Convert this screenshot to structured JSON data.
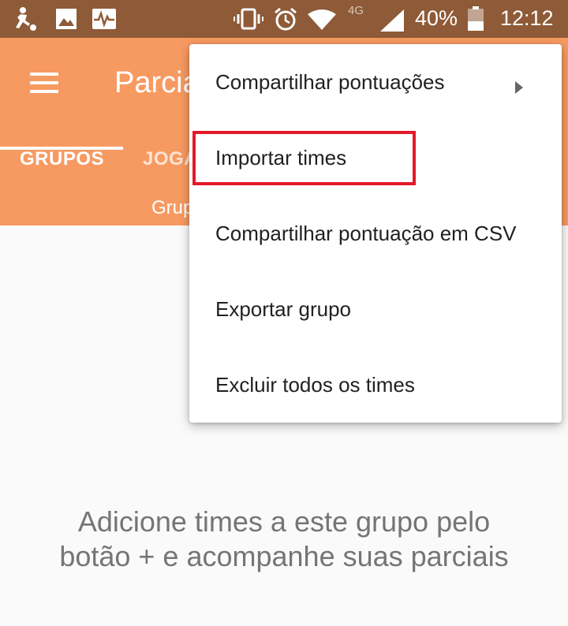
{
  "status_bar": {
    "icons": [
      "soccer-player-icon",
      "image-icon",
      "pulse-icon",
      "vibrate-icon",
      "alarm-icon",
      "wifi-icon",
      "signal-icon",
      "battery-icon"
    ],
    "network": "4G",
    "battery": "40%",
    "time": "12:12"
  },
  "app_bar": {
    "title": "Parciais",
    "tabs": [
      {
        "label": "GRUPOS",
        "active": true
      },
      {
        "label": "JOGADORES",
        "active": false
      }
    ]
  },
  "sub_header": {
    "text": "Grupo"
  },
  "empty_state": {
    "message": "Adicione times a este grupo pelo botão + e acompanhe suas parciais"
  },
  "menu": {
    "items": [
      {
        "label": "Compartilhar pontuações",
        "has_submenu": true
      },
      {
        "label": "Importar times",
        "highlighted": true
      },
      {
        "label": "Compartilhar pontuação em CSV"
      },
      {
        "label": "Exportar grupo"
      },
      {
        "label": "Excluir todos os times"
      }
    ]
  },
  "colors": {
    "status_bar": "#8e5a37",
    "primary": "#f79a62",
    "highlight_border": "#e3192a"
  }
}
